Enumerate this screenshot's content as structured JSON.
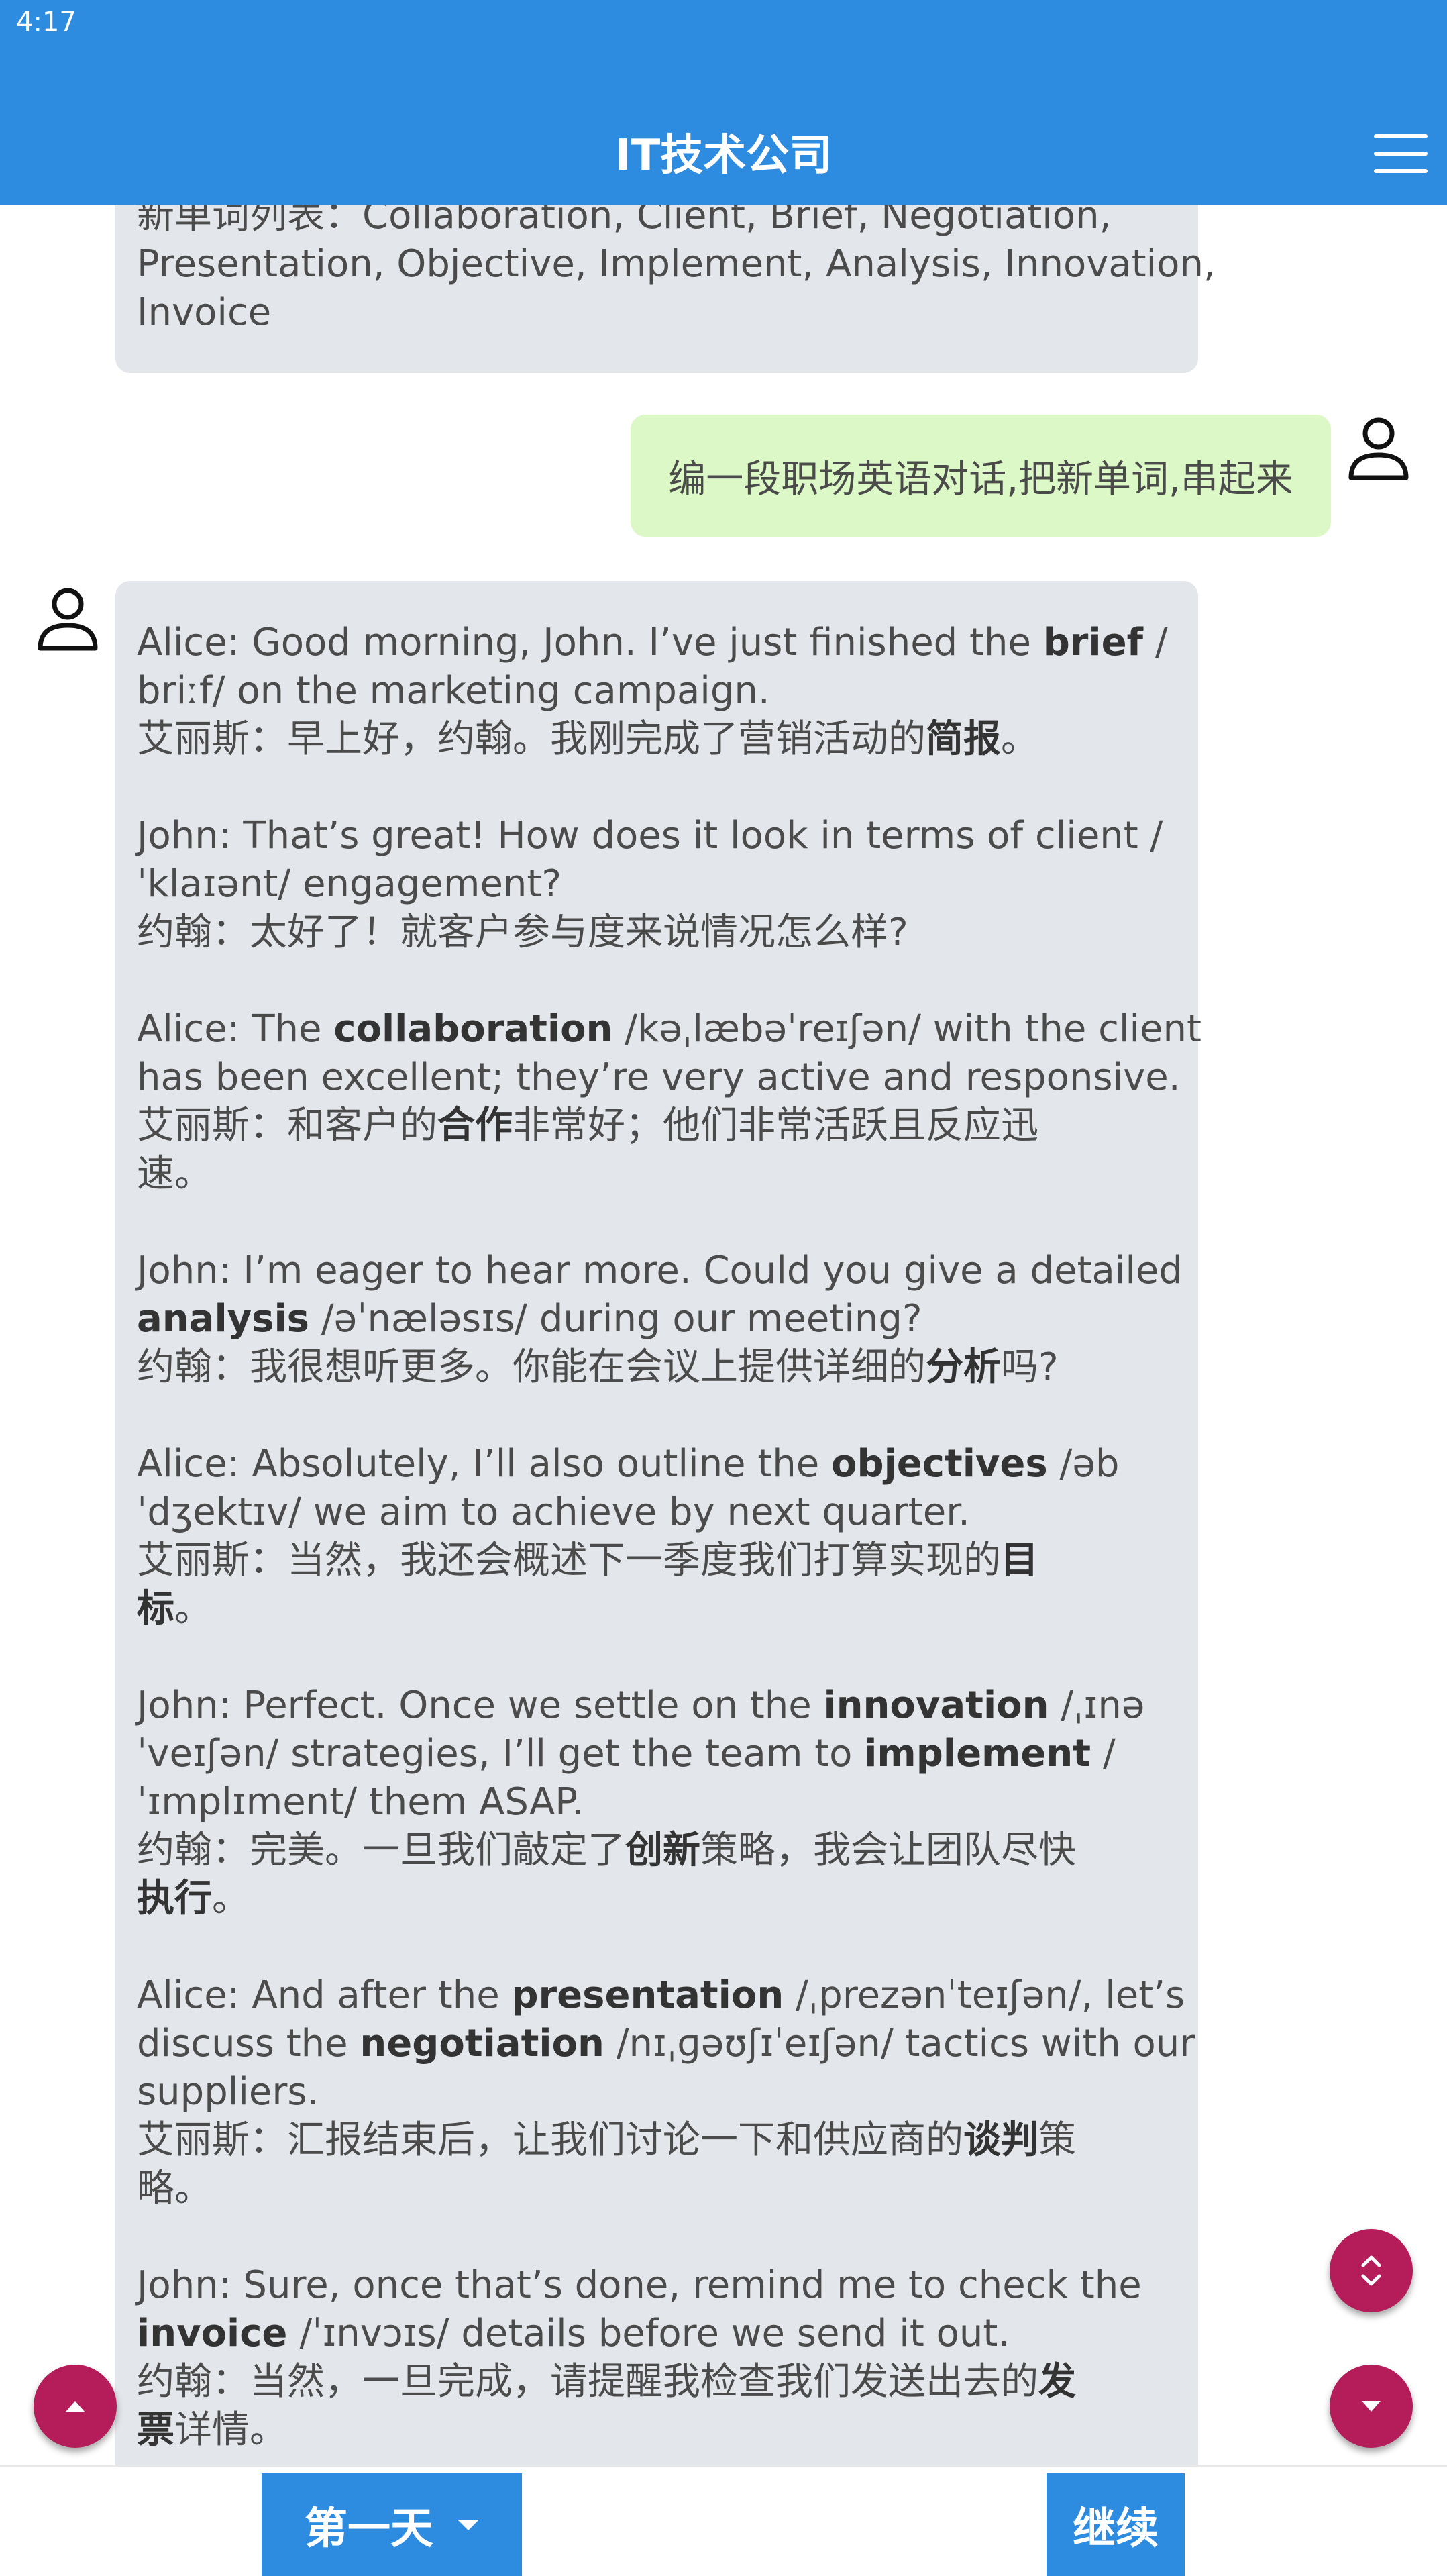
{
  "status_bar": {
    "time": "4:17"
  },
  "app_bar": {
    "title": "IT技术公司"
  },
  "chat": {
    "prev_message": [
      "新单词列表：Collaboration, Client, Brief, Negotiation,",
      "Presentation, Objective, Implement, Analysis, Innovation,",
      "Invoice"
    ],
    "user_message": "编一段职场英语对话,把新单词,串起来",
    "dialogue": [
      {
        "en": [
          [
            {
              "t": "Alice: Good morning, John. I’ve just finished the "
            },
            {
              "t": "brief",
              "b": true
            },
            {
              "t": " /"
            }
          ],
          [
            {
              "t": "briːf/ on the marketing campaign."
            }
          ]
        ],
        "zh": [
          [
            {
              "t": "艾丽斯：早上好，约翰。我刚完成了营销活动的"
            },
            {
              "t": "简报",
              "b": true
            },
            {
              "t": "。"
            }
          ]
        ]
      },
      {
        "en": [
          [
            {
              "t": "John: That’s great! How does it look in terms of client /"
            }
          ],
          [
            {
              "t": "ˈklaɪənt/ engagement?"
            }
          ]
        ],
        "zh": [
          [
            {
              "t": "约翰：太好了！就客户参与度来说情况怎么样?"
            }
          ]
        ]
      },
      {
        "en": [
          [
            {
              "t": "Alice: The "
            },
            {
              "t": "collaboration",
              "b": true
            },
            {
              "t": " /kəˌlæbəˈreɪʃən/ with the client"
            }
          ],
          [
            {
              "t": "has been excellent; they’re very active and responsive."
            }
          ]
        ],
        "zh": [
          [
            {
              "t": "艾丽斯：和客户的"
            },
            {
              "t": "合作",
              "b": true
            },
            {
              "t": "非常好；他们非常活跃且反应迅"
            }
          ],
          [
            {
              "t": "速。"
            }
          ]
        ]
      },
      {
        "en": [
          [
            {
              "t": "John: I’m eager to hear more. Could you give a detailed"
            }
          ],
          [
            {
              "t": "analysis",
              "b": true
            },
            {
              "t": " /əˈnæləsɪs/ during our meeting?"
            }
          ]
        ],
        "zh": [
          [
            {
              "t": "约翰：我很想听更多。你能在会议上提供详细的"
            },
            {
              "t": "分析",
              "b": true
            },
            {
              "t": "吗?"
            }
          ]
        ]
      },
      {
        "en": [
          [
            {
              "t": "Alice: Absolutely, I’ll also outline the "
            },
            {
              "t": "objectives",
              "b": true
            },
            {
              "t": " /əb"
            }
          ],
          [
            {
              "t": "ˈdʒektɪv/ we aim to achieve by next quarter."
            }
          ]
        ],
        "zh": [
          [
            {
              "t": "艾丽斯：当然，我还会概述下一季度我们打算实现的"
            },
            {
              "t": "目",
              "b": true
            }
          ],
          [
            {
              "t": "标",
              "b": true
            },
            {
              "t": "。"
            }
          ]
        ]
      },
      {
        "en": [
          [
            {
              "t": "John: Perfect. Once we settle on the "
            },
            {
              "t": "innovation",
              "b": true
            },
            {
              "t": " /ˌɪnə"
            }
          ],
          [
            {
              "t": "ˈveɪʃən/ strategies, I’ll get the team to "
            },
            {
              "t": "implement",
              "b": true
            },
            {
              "t": " /"
            }
          ],
          [
            {
              "t": "ˈɪmplɪment/ them ASAP."
            }
          ]
        ],
        "zh": [
          [
            {
              "t": "约翰：完美。一旦我们敲定了"
            },
            {
              "t": "创新",
              "b": true
            },
            {
              "t": "策略，我会让团队尽快"
            }
          ],
          [
            {
              "t": "执行",
              "b": true
            },
            {
              "t": "。"
            }
          ]
        ]
      },
      {
        "en": [
          [
            {
              "t": "Alice: And after the "
            },
            {
              "t": "presentation",
              "b": true
            },
            {
              "t": " /ˌprezənˈteɪʃən/, let’s"
            }
          ],
          [
            {
              "t": "discuss the "
            },
            {
              "t": "negotiation",
              "b": true
            },
            {
              "t": " /nɪˌɡəʊʃɪˈeɪʃən/ tactics with our"
            }
          ],
          [
            {
              "t": "suppliers."
            }
          ]
        ],
        "zh": [
          [
            {
              "t": "艾丽斯：汇报结束后，让我们讨论一下和供应商的"
            },
            {
              "t": "谈判",
              "b": true
            },
            {
              "t": "策"
            }
          ],
          [
            {
              "t": "略。"
            }
          ]
        ]
      },
      {
        "en": [
          [
            {
              "t": "John: Sure, once that’s done, remind me to check the"
            }
          ],
          [
            {
              "t": "invoice",
              "b": true
            },
            {
              "t": " /ˈɪnvɔɪs/ details before we send it out."
            }
          ]
        ],
        "zh": [
          [
            {
              "t": "约翰：当然，一旦完成，请提醒我检查我们发送出去的"
            },
            {
              "t": "发",
              "b": true
            }
          ],
          [
            {
              "t": "票",
              "b": true
            },
            {
              "t": "详情。"
            }
          ]
        ]
      }
    ]
  },
  "bottom_bar": {
    "day_selector": "第一天",
    "continue_label": "继续"
  },
  "icons": {
    "menu": "hamburger-menu-icon",
    "avatar": "person-outline-icon",
    "scroll_updown": "chevron-up-down-icon",
    "scroll_down": "caret-down-icon",
    "scroll_up": "caret-up-icon"
  },
  "colors": {
    "primary": "#2d8ce0",
    "fab": "#b51c5a",
    "ai_bubble": "#e3e6ea",
    "user_bubble": "#dcf8c6"
  }
}
